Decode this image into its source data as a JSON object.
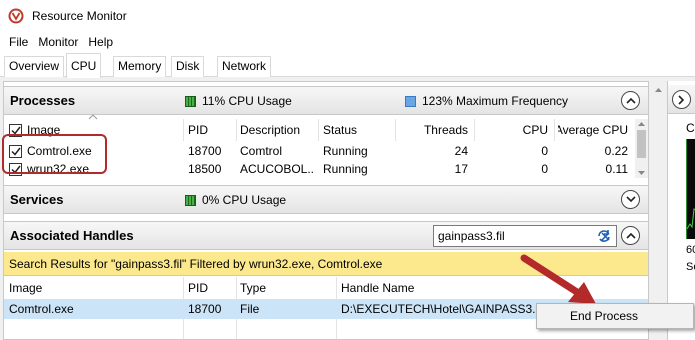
{
  "window": {
    "title": "Resource Monitor"
  },
  "menu": [
    "File",
    "Monitor",
    "Help"
  ],
  "tabs": [
    "Overview",
    "CPU",
    "Memory",
    "Disk",
    "Network"
  ],
  "processes": {
    "title": "Processes",
    "cpu_usage": "11% CPU Usage",
    "max_frequency": "123% Maximum Frequency",
    "columns": [
      "Image",
      "PID",
      "Description",
      "Status",
      "Threads",
      "CPU",
      "Average CPU"
    ],
    "rows": [
      {
        "image": "Comtrol.exe",
        "pid": "18700",
        "description": "Comtrol",
        "status": "Running",
        "threads": "24",
        "cpu": "0",
        "avg_cpu": "0.22"
      },
      {
        "image": "wrun32.exe",
        "pid": "18500",
        "description": "ACUCOBOL...",
        "status": "Running",
        "threads": "17",
        "cpu": "0",
        "avg_cpu": "0.11"
      }
    ]
  },
  "services": {
    "title": "Services",
    "cpu_usage": "0% CPU Usage"
  },
  "handles": {
    "title": "Associated Handles",
    "search_value": "gainpass3.fil",
    "filter_text": "Search Results for \"gainpass3.fil\" Filtered by wrun32.exe, Comtrol.exe",
    "columns": [
      "Image",
      "PID",
      "Type",
      "Handle Name"
    ],
    "rows": [
      {
        "image": "Comtrol.exe",
        "pid": "18700",
        "type": "File",
        "handle_name": "D:\\EXECUTECH\\Hotel\\GAINPASS3.FIL"
      }
    ]
  },
  "side_pane": {
    "line1": "C",
    "line2": "60",
    "line3": "Se"
  },
  "context_menu": {
    "item": "End Process"
  },
  "colors": {
    "annotation": "#b22a2a",
    "filter_bar": "#fde98d",
    "selected_row": "#cce4f7"
  }
}
